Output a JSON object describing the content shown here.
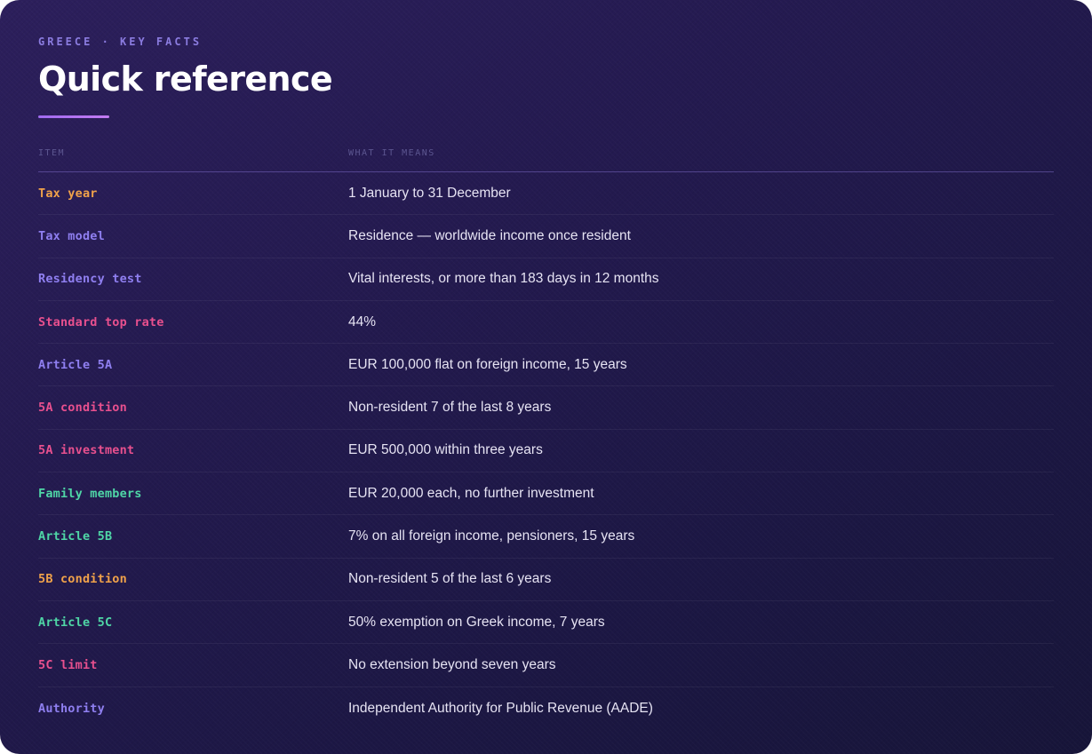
{
  "header": {
    "eyebrow": "GREECE · KEY FACTS",
    "title": "Quick reference"
  },
  "table": {
    "columns": {
      "item": "ITEM",
      "meaning": "WHAT IT MEANS"
    },
    "rows": [
      {
        "item": "Tax year",
        "meaning": "1 January to 31 December",
        "color": "#f0a24a"
      },
      {
        "item": "Tax model",
        "meaning": "Residence — worldwide income once resident",
        "color": "#8f7ff0"
      },
      {
        "item": "Residency test",
        "meaning": "Vital interests, or more than 183 days in 12 months",
        "color": "#8f7ff0"
      },
      {
        "item": "Standard top rate",
        "meaning": "44%",
        "color": "#e8508e"
      },
      {
        "item": "Article 5A",
        "meaning": "EUR 100,000 flat on foreign income, 15 years",
        "color": "#8f7ff0"
      },
      {
        "item": "5A condition",
        "meaning": "Non-resident 7 of the last 8 years",
        "color": "#e8508e"
      },
      {
        "item": "5A investment",
        "meaning": "EUR 500,000 within three years",
        "color": "#e8508e"
      },
      {
        "item": "Family members",
        "meaning": "EUR 20,000 each, no further investment",
        "color": "#4fd6a6"
      },
      {
        "item": "Article 5B",
        "meaning": "7% on all foreign income, pensioners, 15 years",
        "color": "#4fd6a6"
      },
      {
        "item": "5B condition",
        "meaning": "Non-resident 5 of the last 6 years",
        "color": "#f0a24a"
      },
      {
        "item": "Article 5C",
        "meaning": "50% exemption on Greek income, 7 years",
        "color": "#4fd6a6"
      },
      {
        "item": "5C limit",
        "meaning": "No extension beyond seven years",
        "color": "#e8508e"
      },
      {
        "item": "Authority",
        "meaning": "Independent Authority for Public Revenue (AADE)",
        "color": "#8f7ff0"
      }
    ]
  }
}
